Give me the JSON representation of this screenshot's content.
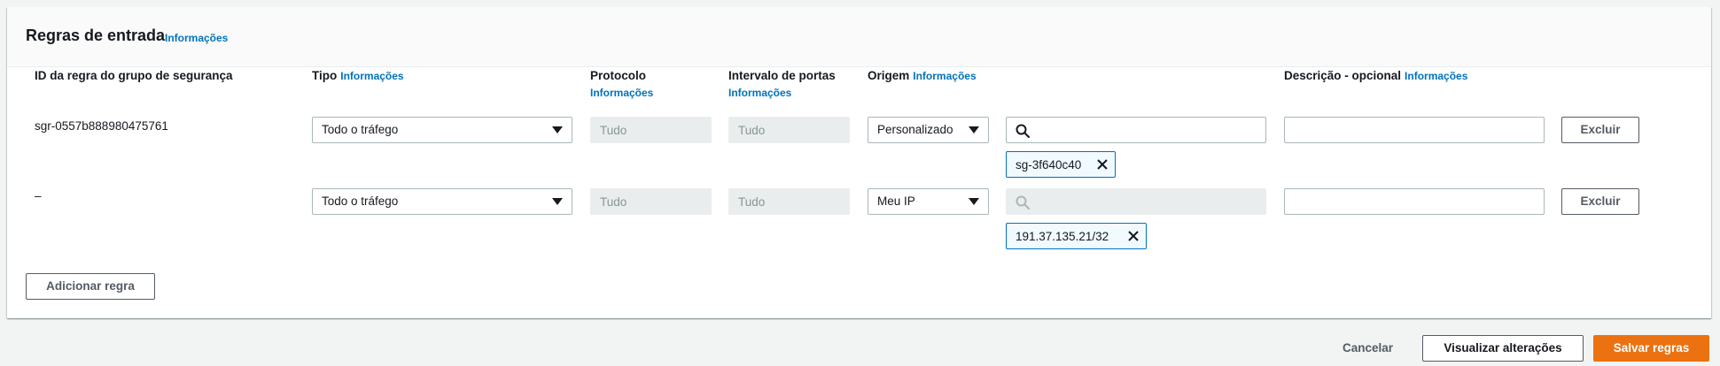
{
  "panel": {
    "title": "Regras de entrada",
    "info_label": "Informações"
  },
  "columns": {
    "rule_id": "ID da regra do grupo de segurança",
    "type": "Tipo",
    "type_info": "Informações",
    "protocol": "Protocolo",
    "protocol_info": "Informações",
    "port_range": "Intervalo de portas",
    "port_range_info": "Informações",
    "source": "Origem",
    "source_info": "Informações",
    "description": "Descrição - opcional",
    "description_info": "Informações"
  },
  "rules": [
    {
      "id": "sgr-0557b888980475761",
      "type": "Todo o tráfego",
      "protocol": "Tudo",
      "port_range": "Tudo",
      "source_type": "Personalizado",
      "source_search_value": "",
      "source_token": "sg-3f640c40",
      "description": "",
      "delete_label": "Excluir"
    },
    {
      "id": "–",
      "type": "Todo o tráfego",
      "protocol": "Tudo",
      "port_range": "Tudo",
      "source_type": "Meu IP",
      "source_search_value": "",
      "source_token": "191.37.135.21/32",
      "description": "",
      "delete_label": "Excluir"
    }
  ],
  "add_rule_label": "Adicionar regra",
  "footer": {
    "cancel_label": "Cancelar",
    "preview_label": "Visualizar alterações",
    "save_label": "Salvar regras"
  },
  "colors": {
    "accent_link": "#0073bb",
    "primary_button": "#ec7211",
    "token_border": "#0073bb",
    "disabled_bg": "#eaeded"
  },
  "icons": {
    "search": "search-icon",
    "dropdown": "caret-down-icon",
    "remove_token": "close-icon"
  }
}
